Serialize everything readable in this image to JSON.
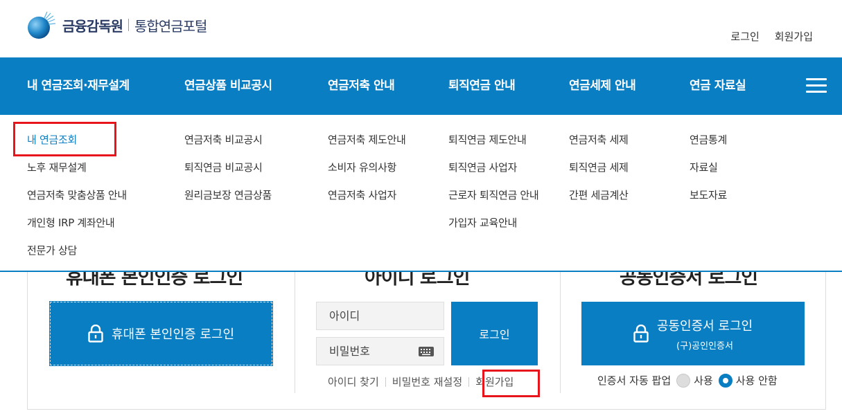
{
  "header": {
    "org_name": "금융감독원",
    "portal_name": "통합연금포털",
    "login": "로그인",
    "signup": "회원가입"
  },
  "nav": {
    "items": [
      {
        "label": "내 연금조회·재무설계"
      },
      {
        "label": "연금상품 비교공시"
      },
      {
        "label": "연금저축 안내"
      },
      {
        "label": "퇴직연금 안내"
      },
      {
        "label": "연금세제 안내"
      },
      {
        "label": "연금 자료실"
      }
    ]
  },
  "dropdown": {
    "col1": [
      "내 연금조회",
      "노후 재무설계",
      "연금저축 맞춤상품 안내",
      "개인형 IRP 계좌안내",
      "전문가 상담"
    ],
    "col2": [
      "연금저축 비교공시",
      "퇴직연금 비교공시",
      "원리금보장 연금상품"
    ],
    "col3": [
      "연금저축 제도안내",
      "소비자 유의사항",
      "연금저축 사업자"
    ],
    "col4": [
      "퇴직연금 제도안내",
      "퇴직연금 사업자",
      "근로자 퇴직연금 안내",
      "가입자 교육안내"
    ],
    "col5": [
      "연금저축 세제",
      "퇴직연금 세제",
      "간편 세금계산"
    ],
    "col6": [
      "연금통계",
      "자료실",
      "보도자료"
    ]
  },
  "login": {
    "phone_title": "휴대폰 본인인증 로그인",
    "phone_button": "휴대폰 본인인증 로그인",
    "id_title": "아이디 로그인",
    "id_placeholder": "아이디",
    "pw_placeholder": "비밀번호",
    "login_button": "로그인",
    "find_id": "아이디 찾기",
    "reset_pw": "비밀번호 재설정",
    "signup": "회원가입",
    "cert_title": "공동인증서 로그인",
    "cert_button": "공동인증서 로그인",
    "cert_sub": "(구)공인인증서",
    "popup_label": "인증서 자동 팝업",
    "popup_use": "사용",
    "popup_no_use": "사용 안함",
    "popup_selected": "사용 안함"
  },
  "colors": {
    "primary": "#0a7ec2",
    "highlight": "#e8141c"
  }
}
